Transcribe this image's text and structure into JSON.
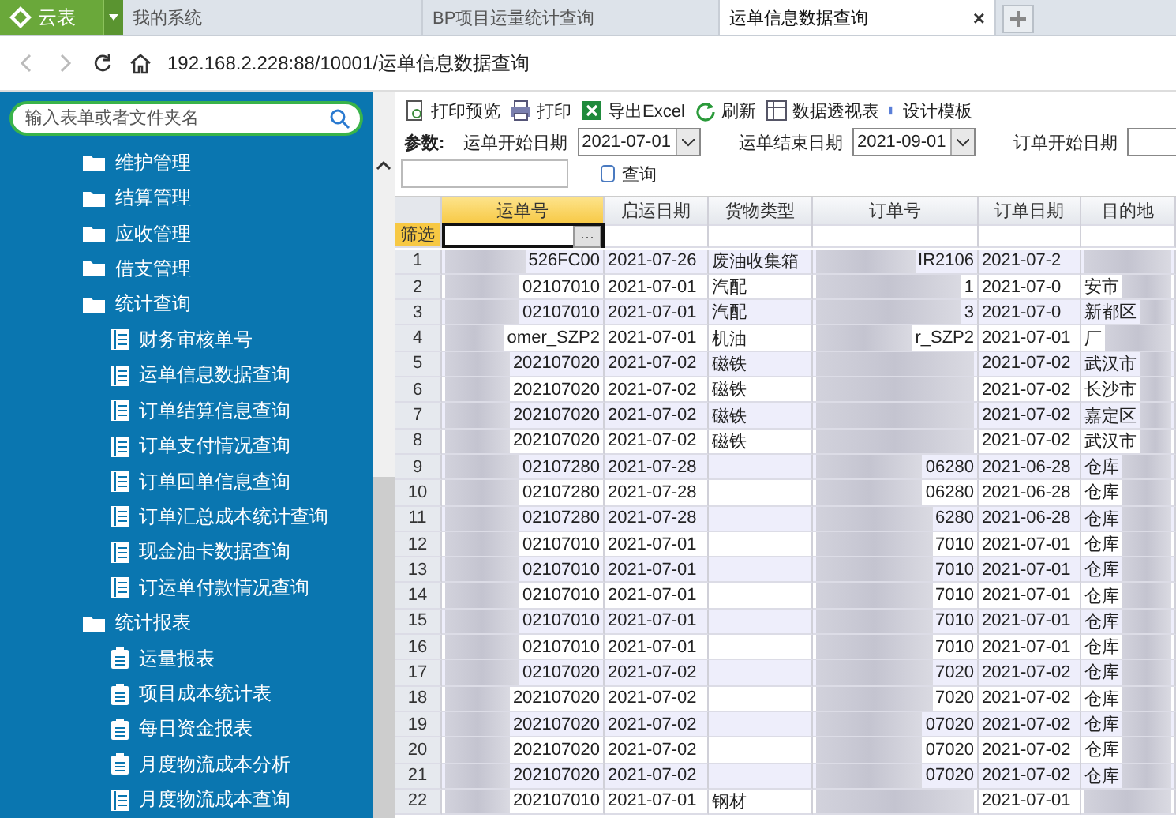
{
  "app_button": {
    "label": "云表"
  },
  "tabs": [
    {
      "label": "我的系统",
      "selected": false
    },
    {
      "label": "BP项目运量统计查询",
      "selected": false
    },
    {
      "label": "运单信息数据查询",
      "selected": true,
      "close": "×"
    }
  ],
  "address": {
    "url": "192.168.2.228:88/10001/运单信息数据查询"
  },
  "sidebar": {
    "search": {
      "placeholder": "输入表单或者文件夹名"
    },
    "items": [
      {
        "label": "维护管理",
        "kind": "folder"
      },
      {
        "label": "结算管理",
        "kind": "folder"
      },
      {
        "label": "应收管理",
        "kind": "folder"
      },
      {
        "label": "借支管理",
        "kind": "folder"
      },
      {
        "label": "统计查询",
        "kind": "folder",
        "children": [
          {
            "label": "财务审核单号",
            "kind": "query"
          },
          {
            "label": "运单信息数据查询",
            "kind": "query"
          },
          {
            "label": "订单结算信息查询",
            "kind": "query"
          },
          {
            "label": "订单支付情况查询",
            "kind": "query"
          },
          {
            "label": "订单回单信息查询",
            "kind": "query"
          },
          {
            "label": "订单汇总成本统计查询",
            "kind": "query"
          },
          {
            "label": "现金油卡数据查询",
            "kind": "query"
          },
          {
            "label": "订运单付款情况查询",
            "kind": "query"
          }
        ]
      },
      {
        "label": "统计报表",
        "kind": "folder",
        "children": [
          {
            "label": "运量报表",
            "kind": "report"
          },
          {
            "label": "项目成本统计表",
            "kind": "report"
          },
          {
            "label": "每日资金报表",
            "kind": "report"
          },
          {
            "label": "月度物流成本分析",
            "kind": "report"
          },
          {
            "label": "月度物流成本查询",
            "kind": "query"
          }
        ]
      }
    ]
  },
  "toolbar": [
    {
      "label": "打印预览",
      "kind": "preview"
    },
    {
      "label": "打印",
      "kind": "print"
    },
    {
      "label": "导出Excel",
      "kind": "excel"
    },
    {
      "label": "刷新",
      "kind": "refresh"
    },
    {
      "label": "数据透视表",
      "kind": "pivot"
    },
    {
      "label": "设计模板",
      "kind": "design"
    }
  ],
  "params": {
    "label": "参数:",
    "fields": [
      {
        "label": "运单开始日期",
        "value": "2021-07-01"
      },
      {
        "label": "运单结束日期",
        "value": "2021-09-01"
      },
      {
        "label": "订单开始日期"
      }
    ],
    "query_button": "查询"
  },
  "table": {
    "columns": [
      {
        "label": "运单号",
        "selected": true
      },
      {
        "label": "启运日期",
        "selected": false
      },
      {
        "label": "货物类型",
        "selected": false
      },
      {
        "label": "订单号",
        "selected": false
      },
      {
        "label": "订单日期",
        "selected": false
      },
      {
        "label": "目的地",
        "selected": false
      }
    ],
    "filter_label": "筛选",
    "filter_button": "···",
    "rows": [
      {
        "n": "1",
        "cells": [
          "526FC00",
          "2021-07-26",
          "废油收集箱",
          "IR2106",
          "2021-07-2",
          ""
        ]
      },
      {
        "n": "2",
        "cells": [
          "02107010",
          "2021-07-01",
          "汽配",
          "1",
          "2021-07-0",
          "安市"
        ]
      },
      {
        "n": "3",
        "cells": [
          "02107010",
          "2021-07-01",
          "汽配",
          "3",
          "2021-07-0",
          "新都区"
        ]
      },
      {
        "n": "4",
        "cells": [
          "omer_SZP2",
          "2021-07-01",
          "机油",
          "r_SZP2",
          "2021-07-01",
          "厂"
        ]
      },
      {
        "n": "5",
        "cells": [
          "202107020",
          "2021-07-02",
          "磁铁",
          "",
          "2021-07-02",
          "武汉市"
        ]
      },
      {
        "n": "6",
        "cells": [
          "202107020",
          "2021-07-02",
          "磁铁",
          "",
          "2021-07-02",
          "长沙市"
        ]
      },
      {
        "n": "7",
        "cells": [
          "202107020",
          "2021-07-02",
          "磁铁",
          "",
          "2021-07-02",
          "嘉定区"
        ]
      },
      {
        "n": "8",
        "cells": [
          "202107020",
          "2021-07-02",
          "磁铁",
          "",
          "2021-07-02",
          "武汉市"
        ]
      },
      {
        "n": "9",
        "cells": [
          "02107280",
          "2021-07-28",
          "",
          "06280",
          "2021-06-28",
          "仓库"
        ]
      },
      {
        "n": "10",
        "cells": [
          "02107280",
          "2021-07-28",
          "",
          "06280",
          "2021-06-28",
          "仓库"
        ]
      },
      {
        "n": "11",
        "cells": [
          "02107280",
          "2021-07-28",
          "",
          "6280",
          "2021-06-28",
          "仓库"
        ]
      },
      {
        "n": "12",
        "cells": [
          "02107010",
          "2021-07-01",
          "",
          "7010",
          "2021-07-01",
          "仓库"
        ]
      },
      {
        "n": "13",
        "cells": [
          "02107010",
          "2021-07-01",
          "",
          "7010",
          "2021-07-01",
          "仓库"
        ]
      },
      {
        "n": "14",
        "cells": [
          "02107010",
          "2021-07-01",
          "",
          "7010",
          "2021-07-01",
          "仓库"
        ]
      },
      {
        "n": "15",
        "cells": [
          "02107010",
          "2021-07-01",
          "",
          "7010",
          "2021-07-01",
          "仓库"
        ]
      },
      {
        "n": "16",
        "cells": [
          "02107010",
          "2021-07-01",
          "",
          "7010",
          "2021-07-01",
          "仓库"
        ]
      },
      {
        "n": "17",
        "cells": [
          "02107020",
          "2021-07-02",
          "",
          "7020",
          "2021-07-02",
          "仓库"
        ]
      },
      {
        "n": "18",
        "cells": [
          "202107020",
          "2021-07-02",
          "",
          "7020",
          "2021-07-02",
          "仓库"
        ]
      },
      {
        "n": "19",
        "cells": [
          "202107020",
          "2021-07-02",
          "",
          "07020",
          "2021-07-02",
          "仓库"
        ]
      },
      {
        "n": "20",
        "cells": [
          "202107020",
          "2021-07-02",
          "",
          "07020",
          "2021-07-02",
          "仓库"
        ]
      },
      {
        "n": "21",
        "cells": [
          "202107020",
          "2021-07-02",
          "",
          "07020",
          "2021-07-02",
          "仓库"
        ]
      },
      {
        "n": "22",
        "cells": [
          "202107010",
          "2021-07-01",
          "钢材",
          "",
          "2021-07-01",
          ""
        ]
      }
    ]
  }
}
